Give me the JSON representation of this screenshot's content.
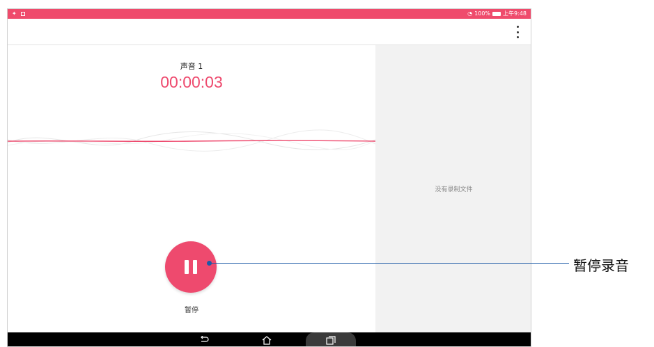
{
  "status_bar": {
    "battery": "100%",
    "time": "上午9:48"
  },
  "recording": {
    "name": "声音 1",
    "elapsed": "00:00:03"
  },
  "controls": {
    "pause_label": "暂停"
  },
  "sidebar": {
    "empty_message": "没有录制文件"
  },
  "callout": {
    "label": "暂停录音"
  },
  "colors": {
    "accent": "#ee4a6e",
    "status_bar": "#ef4b6c",
    "callout": "#1c5aa6",
    "side_pane": "#f2f2f2"
  },
  "icons": {
    "overflow": "more-vert-icon",
    "pause": "pause-icon",
    "back": "back-icon",
    "home": "home-icon",
    "recent": "recent-apps-icon"
  }
}
